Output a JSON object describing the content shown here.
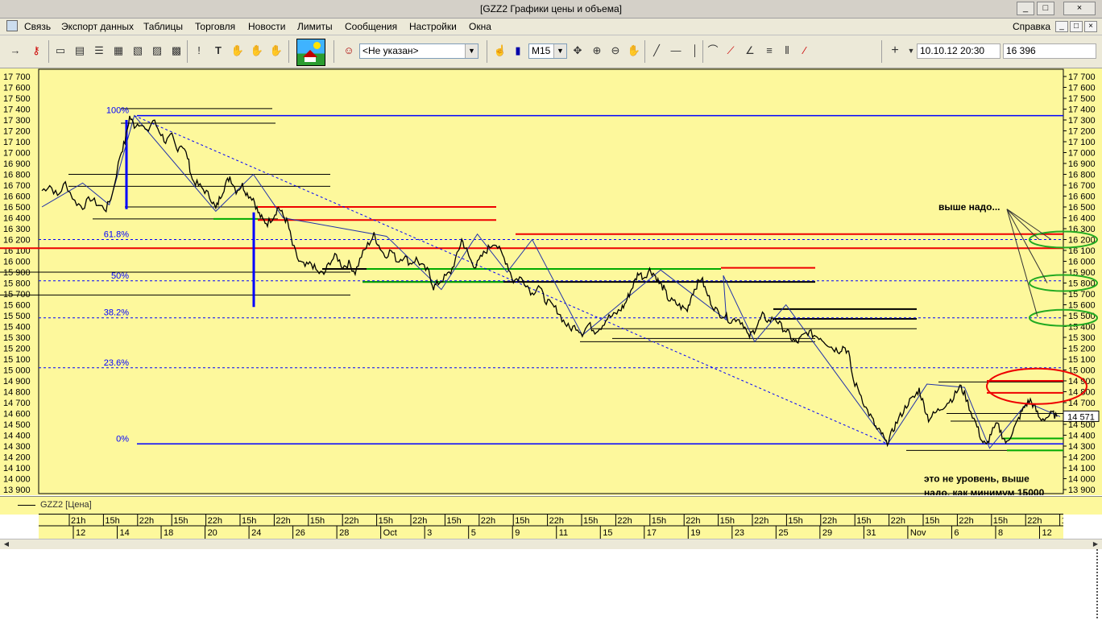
{
  "window": {
    "title": "[GZZ2 Графики цены и объема]",
    "min": "_",
    "max": "□",
    "close": "×"
  },
  "menu": {
    "items": [
      "Связь",
      "Экспорт данных",
      "Таблицы",
      "Торговля",
      "Новости",
      "Лимиты",
      "Сообщения",
      "Настройки",
      "Окна"
    ],
    "help": "Справка",
    "mdi_min": "_",
    "mdi_max": "□",
    "mdi_close": "×"
  },
  "toolbar": {
    "account_value": "<Не указан>",
    "interval_value": "M15",
    "datetime_value": "10.10.12 20:30",
    "price_value": "16 396",
    "plus_label": "+"
  },
  "chart_data": {
    "type": "line",
    "instrument": "GZZ2",
    "legend": "GZZ2 [Цена]",
    "ylim": [
      13900,
      17700
    ],
    "yticks": [
      17700,
      17600,
      17500,
      17400,
      17300,
      17200,
      17100,
      17000,
      16900,
      16800,
      16700,
      16600,
      16500,
      16400,
      16300,
      16200,
      16100,
      16000,
      15900,
      15800,
      15700,
      15600,
      15500,
      15400,
      15300,
      15200,
      15100,
      15000,
      14900,
      14800,
      14700,
      14600,
      14500,
      14400,
      14300,
      14200,
      14100,
      14000,
      13900
    ],
    "current_price_label": "14 571",
    "current_price": 14571,
    "price_path": [
      [
        0,
        16650
      ],
      [
        10,
        16700
      ],
      [
        20,
        16600
      ],
      [
        30,
        16720
      ],
      [
        42,
        16550
      ],
      [
        52,
        16500
      ],
      [
        62,
        16580
      ],
      [
        72,
        16520
      ],
      [
        82,
        16480
      ],
      [
        90,
        16620
      ],
      [
        100,
        16980
      ],
      [
        106,
        17100
      ],
      [
        112,
        17330
      ],
      [
        118,
        17250
      ],
      [
        126,
        17280
      ],
      [
        134,
        17180
      ],
      [
        142,
        17300
      ],
      [
        150,
        17200
      ],
      [
        158,
        17100
      ],
      [
        166,
        17150
      ],
      [
        172,
        17030
      ],
      [
        178,
        17080
      ],
      [
        186,
        16960
      ],
      [
        192,
        16750
      ],
      [
        200,
        16700
      ],
      [
        208,
        16650
      ],
      [
        216,
        16580
      ],
      [
        222,
        16480
      ],
      [
        228,
        16600
      ],
      [
        234,
        16700
      ],
      [
        240,
        16780
      ],
      [
        248,
        16650
      ],
      [
        256,
        16700
      ],
      [
        262,
        16620
      ],
      [
        270,
        16580
      ],
      [
        276,
        16450
      ],
      [
        282,
        16380
      ],
      [
        288,
        16350
      ],
      [
        296,
        16420
      ],
      [
        302,
        16500
      ],
      [
        308,
        16420
      ],
      [
        314,
        16350
      ],
      [
        320,
        16150
      ],
      [
        328,
        16000
      ],
      [
        336,
        15950
      ],
      [
        344,
        15980
      ],
      [
        352,
        15900
      ],
      [
        360,
        15880
      ],
      [
        368,
        16000
      ],
      [
        376,
        16050
      ],
      [
        384,
        15950
      ],
      [
        392,
        15980
      ],
      [
        400,
        15900
      ],
      [
        408,
        16050
      ],
      [
        416,
        16150
      ],
      [
        424,
        16240
      ],
      [
        430,
        16150
      ],
      [
        438,
        16050
      ],
      [
        446,
        16100
      ],
      [
        454,
        16000
      ],
      [
        462,
        16050
      ],
      [
        470,
        15980
      ],
      [
        478,
        16020
      ],
      [
        486,
        15950
      ],
      [
        494,
        15900
      ],
      [
        500,
        15760
      ],
      [
        506,
        15800
      ],
      [
        514,
        15850
      ],
      [
        522,
        15900
      ],
      [
        530,
        16050
      ],
      [
        536,
        16200
      ],
      [
        542,
        16100
      ],
      [
        548,
        16000
      ],
      [
        554,
        15950
      ],
      [
        562,
        16050
      ],
      [
        570,
        16120
      ],
      [
        578,
        16180
      ],
      [
        586,
        16080
      ],
      [
        594,
        15980
      ],
      [
        602,
        15820
      ],
      [
        610,
        15850
      ],
      [
        618,
        15800
      ],
      [
        626,
        15700
      ],
      [
        634,
        15780
      ],
      [
        642,
        15650
      ],
      [
        650,
        15600
      ],
      [
        658,
        15550
      ],
      [
        666,
        15450
      ],
      [
        674,
        15380
      ],
      [
        682,
        15400
      ],
      [
        690,
        15340
      ],
      [
        698,
        15420
      ],
      [
        706,
        15360
      ],
      [
        714,
        15400
      ],
      [
        722,
        15480
      ],
      [
        730,
        15500
      ],
      [
        738,
        15550
      ],
      [
        744,
        15600
      ],
      [
        750,
        15700
      ],
      [
        756,
        15800
      ],
      [
        762,
        15900
      ],
      [
        768,
        15850
      ],
      [
        776,
        15920
      ],
      [
        782,
        15880
      ],
      [
        788,
        15800
      ],
      [
        794,
        15750
      ],
      [
        800,
        15650
      ],
      [
        808,
        15620
      ],
      [
        816,
        15580
      ],
      [
        824,
        15550
      ],
      [
        830,
        15700
      ],
      [
        836,
        15780
      ],
      [
        842,
        15850
      ],
      [
        848,
        15720
      ],
      [
        856,
        15600
      ],
      [
        864,
        15520
      ],
      [
        872,
        15500
      ],
      [
        880,
        15450
      ],
      [
        888,
        15480
      ],
      [
        896,
        15420
      ],
      [
        902,
        15300
      ],
      [
        908,
        15350
      ],
      [
        914,
        15420
      ],
      [
        920,
        15500
      ],
      [
        928,
        15450
      ],
      [
        936,
        15480
      ],
      [
        944,
        15400
      ],
      [
        952,
        15350
      ],
      [
        958,
        15280
      ],
      [
        964,
        15250
      ],
      [
        970,
        15300
      ],
      [
        978,
        15350
      ],
      [
        986,
        15320
      ],
      [
        994,
        15300
      ],
      [
        1002,
        15250
      ],
      [
        1010,
        15200
      ],
      [
        1018,
        15180
      ],
      [
        1024,
        15220
      ],
      [
        1030,
        15150
      ],
      [
        1036,
        14900
      ],
      [
        1044,
        14800
      ],
      [
        1052,
        14650
      ],
      [
        1060,
        14550
      ],
      [
        1066,
        14450
      ],
      [
        1072,
        14420
      ],
      [
        1078,
        14320
      ],
      [
        1084,
        14400
      ],
      [
        1090,
        14500
      ],
      [
        1098,
        14600
      ],
      [
        1106,
        14700
      ],
      [
        1114,
        14750
      ],
      [
        1120,
        14820
      ],
      [
        1126,
        14680
      ],
      [
        1132,
        14550
      ],
      [
        1140,
        14600
      ],
      [
        1148,
        14650
      ],
      [
        1156,
        14700
      ],
      [
        1164,
        14750
      ],
      [
        1172,
        14850
      ],
      [
        1178,
        14780
      ],
      [
        1186,
        14620
      ],
      [
        1194,
        14480
      ],
      [
        1200,
        14350
      ],
      [
        1206,
        14300
      ],
      [
        1212,
        14420
      ],
      [
        1220,
        14500
      ],
      [
        1226,
        14400
      ],
      [
        1232,
        14320
      ],
      [
        1238,
        14420
      ],
      [
        1244,
        14500
      ],
      [
        1250,
        14600
      ],
      [
        1256,
        14680
      ],
      [
        1262,
        14720
      ],
      [
        1268,
        14650
      ],
      [
        1274,
        14550
      ],
      [
        1282,
        14560
      ],
      [
        1290,
        14600
      ],
      [
        1296,
        14571
      ]
    ],
    "zigzag": [
      [
        0,
        16500
      ],
      [
        52,
        16720
      ],
      [
        86,
        16520
      ],
      [
        118,
        17340
      ],
      [
        222,
        16460
      ],
      [
        270,
        16800
      ],
      [
        308,
        16400
      ],
      [
        440,
        16230
      ],
      [
        510,
        15740
      ],
      [
        556,
        16250
      ],
      [
        594,
        15900
      ],
      [
        626,
        16200
      ],
      [
        690,
        15320
      ],
      [
        790,
        15920
      ],
      [
        874,
        15460
      ],
      [
        870,
        15870
      ],
      [
        910,
        15260
      ],
      [
        950,
        15600
      ],
      [
        1080,
        14320
      ],
      [
        1130,
        14870
      ],
      [
        1178,
        14840
      ],
      [
        1210,
        14280
      ],
      [
        1258,
        14700
      ],
      [
        1300,
        14571
      ]
    ],
    "fib_trend_line": [
      [
        118,
        17340
      ],
      [
        1080,
        14320
      ]
    ],
    "fibonacci": [
      {
        "label": "100%",
        "price": 17340
      },
      {
        "label": "61.8%",
        "price": 16200
      },
      {
        "label": "50%",
        "price": 15820
      },
      {
        "label": "38.2%",
        "price": 15480
      },
      {
        "label": "23.6%",
        "price": 15020
      },
      {
        "label": "0%",
        "price": 14320
      }
    ],
    "annotations": [
      {
        "text": "выше надо...",
        "lines": [
          "выше надо..."
        ]
      },
      {
        "text": "это не уровень, выше надо, как минимум 15000",
        "lines": [
          "это не уровень, выше",
          "надо, как минимум 15000"
        ]
      }
    ],
    "x_axis": {
      "hour_labels": [
        "21h",
        "15h",
        "22h",
        "15h",
        "22h",
        "15h",
        "22h",
        "15h",
        "22h",
        "15h",
        "22h",
        "15h",
        "22h",
        "15h",
        "22h",
        "15h",
        "22h",
        "15h",
        "22h",
        "15h",
        "22h",
        "15h",
        "22h",
        "15h",
        "22h",
        "15h",
        "22h",
        "15h",
        "22h",
        "15h"
      ],
      "date_labels": [
        "12",
        "14",
        "18",
        "20",
        "24",
        "26",
        "28",
        "Oct",
        "3",
        "5",
        "9",
        "11",
        "15",
        "17",
        "19",
        "23",
        "25",
        "29",
        "31",
        "Nov",
        "6",
        "8",
        "12"
      ]
    }
  }
}
